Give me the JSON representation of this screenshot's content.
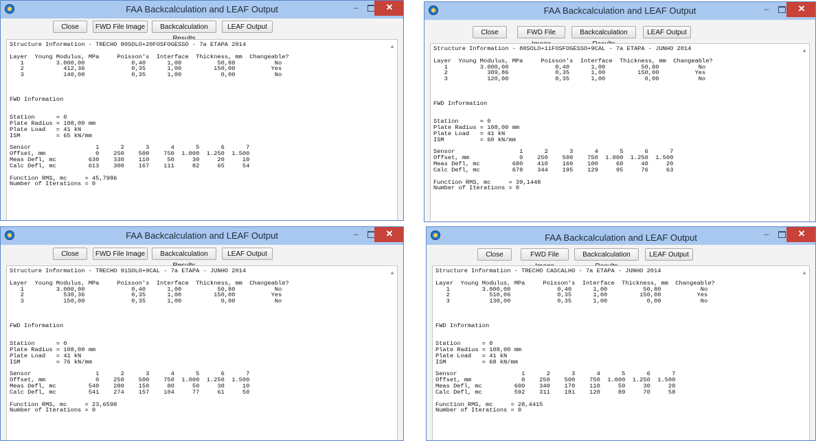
{
  "windows": [
    {
      "title": "FAA Backcalculation and LEAF Output",
      "buttons": {
        "close": "Close",
        "fwd_image": "FWD File Image",
        "backcalc": "Backcalculation Results",
        "leaf": "LEAF Output"
      },
      "controls": {
        "minimize": "–",
        "close": "✕"
      },
      "report_lines": [
        "Structure Information - TRECHO 80SOLO+20FOSFOGESSO - 7a ETAPA 2014",
        "",
        "Layer  Young Modulus, MPa     Poisson's  Interface  Thickness, mm  Changeable?",
        "   1         3.000,00             0,40      1,00          50,80           No",
        "   2           412,36             0,35      1,00         150,00          Yes",
        "   3           140,00             0,35      1,00           0,00           No",
        "",
        "",
        "",
        "FWD Information",
        "",
        "",
        "Station      = 0",
        "Plate Radius = 108,00 mm",
        "Plate Load   = 41 kN",
        "ISM          = 65 kN/mm",
        "",
        "Sensor                  1      2      3      4      5      6      7",
        "Offset, mm              0    250    500    750  1.000  1.250  1.500",
        "Meas Defl, mc         630    330    110     50     30     20     10",
        "Calc Defl, mc         613    300    167    111     82     65     54",
        "",
        "Function RMS, mc     = 45,7986",
        "Number of Iterations = 0"
      ]
    },
    {
      "title": "FAA Backcalculation and LEAF Output",
      "buttons": {
        "close": "Close",
        "fwd_image": "FWD File Image",
        "backcalc": "Backcalculation Results",
        "leaf": "LEAF Output"
      },
      "controls": {
        "minimize": "–",
        "close": "✕"
      },
      "report_lines": [
        "Structure Information - 80SOLO+11FOSFOGESSO+9CAL - 7a ETAPA - JUNHO 2014",
        "",
        "Layer  Young Modulus, MPa     Poisson's  Interface  Thickness, mm  Changeable?",
        "   1         3.000,00             0,40      1,00          50,80           No",
        "   2           389,86             0,35      1,00         150,00          Yes",
        "   3           120,00             0,35      1,00           0,00           No",
        "",
        "",
        "",
        "FWD Information",
        "",
        "",
        "Station      = 0",
        "Plate Radius = 108,00 mm",
        "Plate Load   = 41 kN",
        "ISM          = 60 kN/mm",
        "",
        "Sensor                  1      2      3      4      5      6      7",
        "Offset, mm              0    250    500    750  1.000  1.250  1.500",
        "Meas Defl, mc         680    410    160    100     60     40     20",
        "Calc Defl, mc         678    344    195    129     95     76     63",
        "",
        "Function RMS, mc     = 39,1448",
        "Number of Iterations = 0"
      ]
    },
    {
      "title": "FAA Backcalculation and LEAF Output",
      "buttons": {
        "close": "Close",
        "fwd_image": "FWD File Image",
        "backcalc": "Backcalculation Results",
        "leaf": "LEAF Output"
      },
      "controls": {
        "minimize": "–",
        "close": "✕"
      },
      "report_lines": [
        "Structure Information - TRECHO 91SOLO+9CAL - 7a ETAPA - JUNHO 2014",
        "",
        "Layer  Young Modulus, MPa     Poisson's  Interface  Thickness, mm  Changeable?",
        "   1         3.000,00             0,40      1,00          50,80           No",
        "   2           530,36             0,35      1,00         150,00          Yes",
        "   3           150,00             0,35      1,00           0,00           No",
        "",
        "",
        "",
        "FWD Information",
        "",
        "",
        "Station      = 0",
        "Plate Radius = 108,00 mm",
        "Plate Load   = 41 kN",
        "ISM          = 76 kN/mm",
        "",
        "Sensor                  1      2      3      4      5      6      7",
        "Offset, mm              0    250    500    750  1.000  1.250  1.500",
        "Meas Defl, mc         540    280    150     80     50     30     10",
        "Calc Defl, mc         541    274    157    104     77     61     50",
        "",
        "Function RMS, mc     = 23,6598",
        "Number of Iterations = 0"
      ]
    },
    {
      "title": "FAA Backcalculation and LEAF Output",
      "buttons": {
        "close": "Close",
        "fwd_image": "FWD File Image",
        "backcalc": "Backcalculation Results",
        "leaf": "LEAF Output"
      },
      "controls": {
        "minimize": "–",
        "close": "✕"
      },
      "report_lines": [
        "Structure Information - TRECHO CASCALHO - 7a ETAPA - JUNHO 2014",
        "",
        "Layer  Young Modulus, MPa     Poisson's  Interface  Thickness, mm  Changeable?",
        "   1         3.000,00             0,40      1,00          50,80           No",
        "   2           510,06             0,35      1,00         150,00          Yes",
        "   3           130,00             0,35      1,00           0,00           No",
        "",
        "",
        "",
        "FWD Information",
        "",
        "",
        "Station      = 0",
        "Plate Radius = 108,00 mm",
        "Plate Load   = 41 kN",
        "ISM          = 68 kN/mm",
        "",
        "Sensor                  1      2      3      4      5      6      7",
        "Offset, mm              0    250    500    750  1.000  1.250  1.500",
        "Meas Defl, mc         600    340    170    110     50     30     20",
        "Calc Defl, mc         592    311    181    120     89     70     58",
        "",
        "Function RMS, mc     = 28,4415",
        "Number of Iterations = 0"
      ]
    }
  ]
}
